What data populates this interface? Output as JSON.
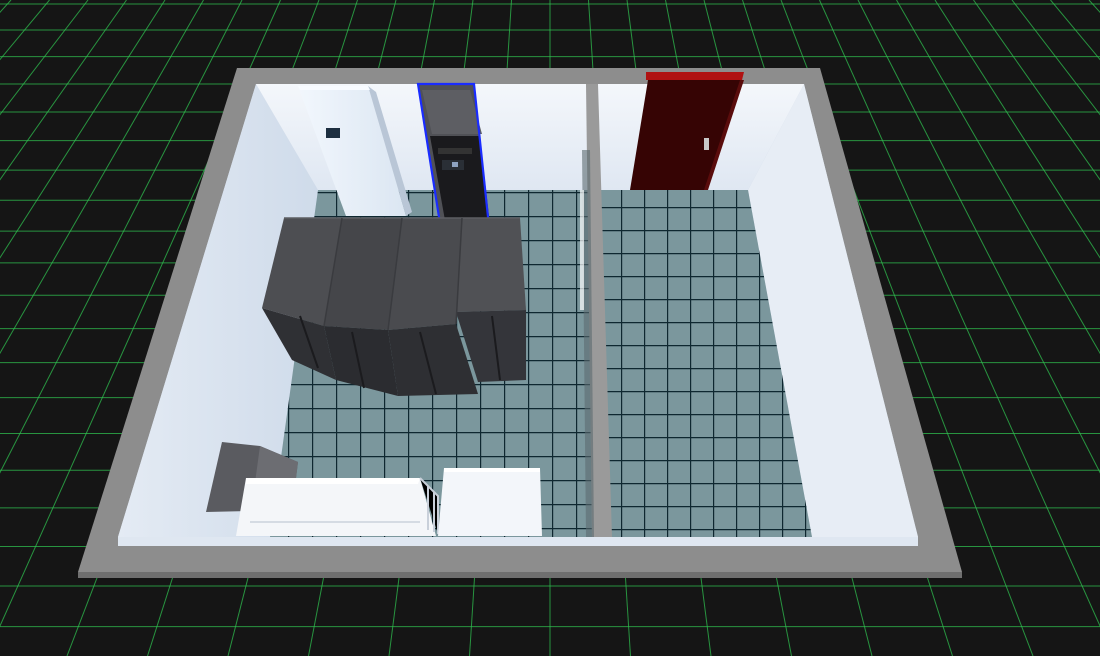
{
  "scene": {
    "kind": "3d-server-room-viewer",
    "colors": {
      "background": "#151515",
      "grid_line": "#2fbf4f",
      "wall_top": "#8a8a8a",
      "wall_inner": "#e6ecf5",
      "floor_tile": "#7f9aa0",
      "floor_gap": "#0d2a36",
      "rack": "#4a4a4e",
      "rack_top": "#55565b",
      "ac_unit": "#e8f0fb",
      "door": "#3a0606",
      "door_frame": "#aa1111",
      "selection_outline": "#1a2cff"
    },
    "objects": {
      "precision_ac": "precision-ac-unit",
      "selected_rack": "selected-rack",
      "rack_row": "server-rack-row",
      "ups_box": "ups-cabinet",
      "battery_rack": "battery-rack",
      "white_cabinet": "white-cabinet",
      "door": "door",
      "partition": "glass-partition"
    }
  }
}
